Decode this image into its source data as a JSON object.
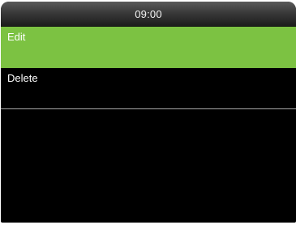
{
  "status_bar": {
    "time": "09:00"
  },
  "menu": {
    "items": [
      {
        "label": "Edit",
        "selected": true
      },
      {
        "label": "Delete",
        "selected": false
      }
    ]
  },
  "colors": {
    "selection_green": "#7cc242",
    "background": "#000000",
    "divider": "#a8a8a8"
  }
}
